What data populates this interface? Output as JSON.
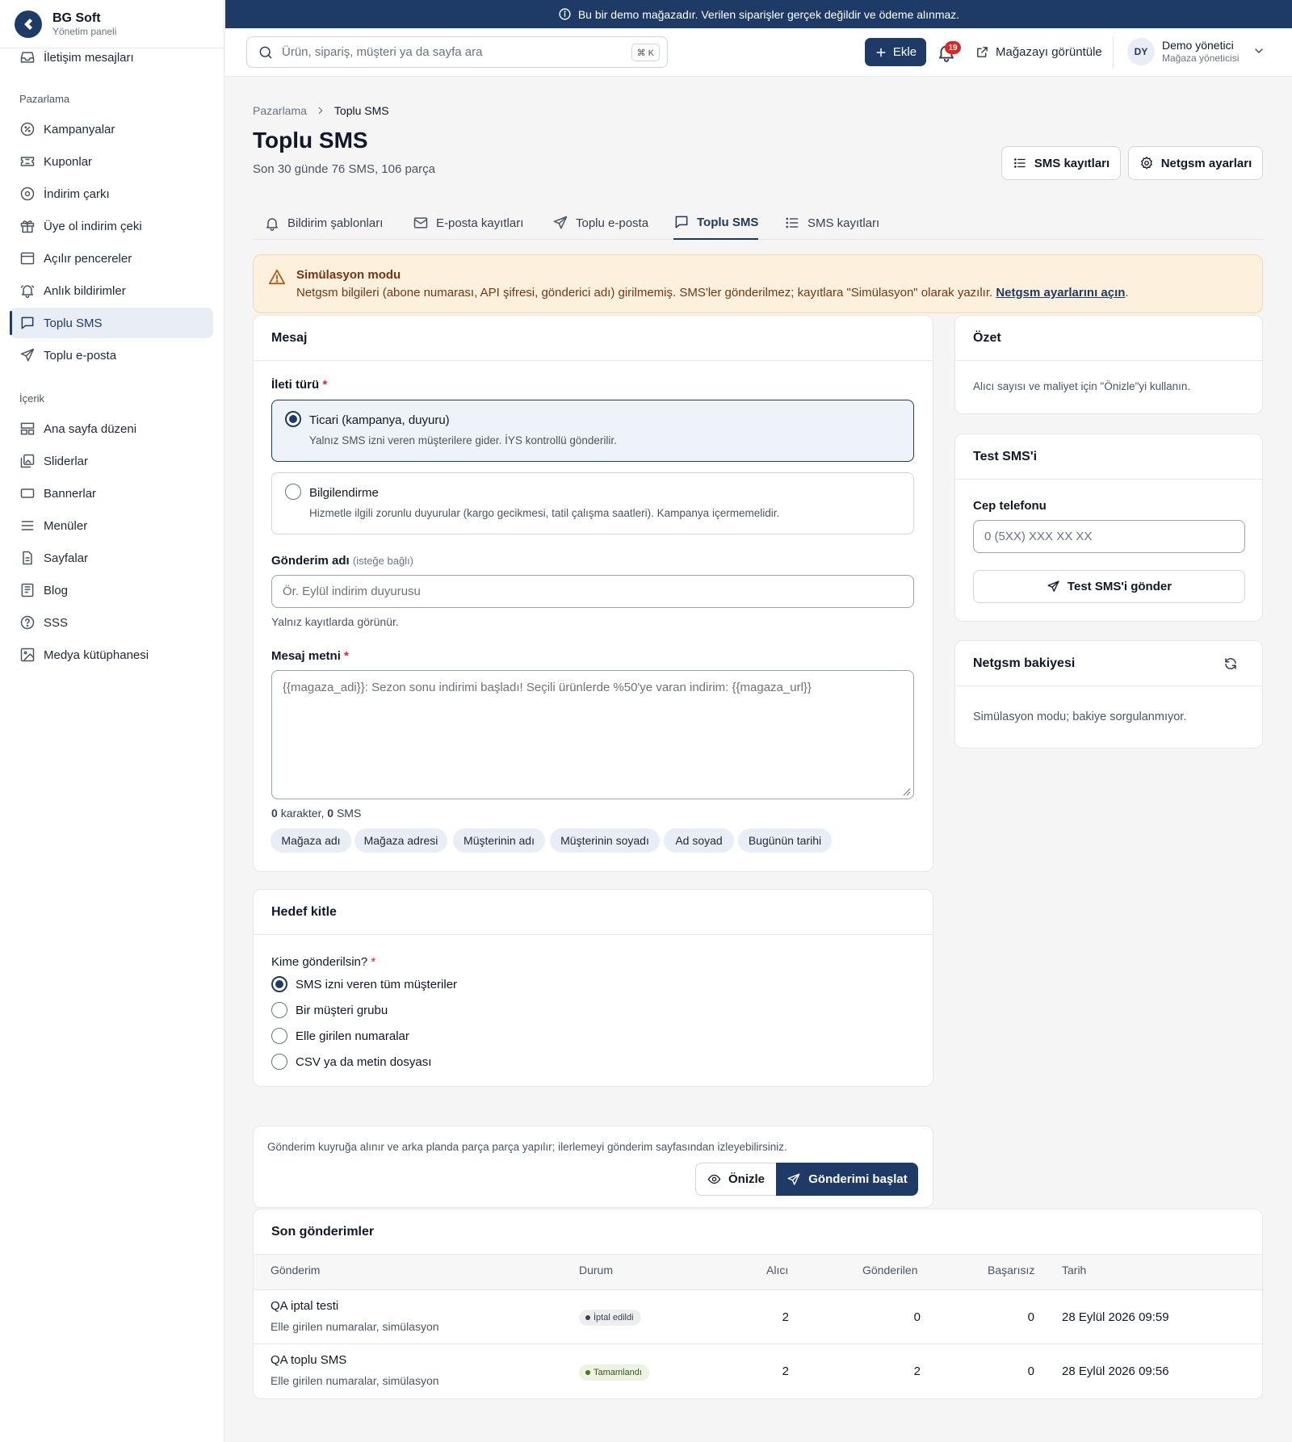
{
  "banner": {
    "text": "Bu bir demo mağazadır. Verilen siparişler gerçek değildir ve ödeme alınmaz."
  },
  "brand": {
    "name": "BG Soft",
    "subtitle": "Yönetim paneli"
  },
  "sidebar": {
    "top_item": "İletişim mesajları",
    "sections": [
      {
        "title": "Pazarlama",
        "items": [
          "Kampanyalar",
          "Kuponlar",
          "İndirim çarkı",
          "Üye ol indirim çeki",
          "Açılır pencereler",
          "Anlık bildirimler",
          "Toplu SMS",
          "Toplu e-posta"
        ]
      },
      {
        "title": "İçerik",
        "items": [
          "Ana sayfa düzeni",
          "Sliderlar",
          "Bannerlar",
          "Menüler",
          "Sayfalar",
          "Blog",
          "SSS",
          "Medya kütüphanesi"
        ]
      }
    ],
    "active_item": "Toplu SMS"
  },
  "header": {
    "search_placeholder": "Ürün, sipariş, müşteri ya da sayfa ara",
    "search_shortcut": "⌘ K",
    "add_label": "Ekle",
    "notification_count": "19",
    "view_store_label": "Mağazayı görüntüle",
    "user": {
      "initials": "DY",
      "name": "Demo yönetici",
      "role": "Mağaza yöneticisi"
    }
  },
  "page": {
    "breadcrumb": [
      "Pazarlama",
      "Toplu SMS"
    ],
    "title": "Toplu SMS",
    "subtitle": "Son 30 günde 76 SMS, 106 parça",
    "actions": {
      "sms_logs": "SMS kayıtları",
      "netgsm_settings": "Netgsm ayarları"
    }
  },
  "tabs": [
    "Bildirim şablonları",
    "E-posta kayıtları",
    "Toplu e-posta",
    "Toplu SMS",
    "SMS kayıtları"
  ],
  "alert": {
    "title": "Simülasyon modu",
    "text": "Netgsm bilgileri (abone numarası, API şifresi, gönderici adı) girilmemiş. SMS'ler gönderilmez; kayıtlara \"Simülasyon\" olarak yazılır.",
    "link": "Netgsm ayarlarını açın",
    "period": "."
  },
  "message_card": {
    "title": "Mesaj",
    "type_label": "İleti türü",
    "types": [
      {
        "title": "Ticari (kampanya, duyuru)",
        "desc": "Yalnız SMS izni veren müşterilere gider. İYS kontrollü gönderilir.",
        "selected": true
      },
      {
        "title": "Bilgilendirme",
        "desc": "Hizmetle ilgili zorunlu duyurular (kargo gecikmesi, tatil çalışma saatleri). Kampanya içermemelidir.",
        "selected": false
      }
    ],
    "send_name_label": "Gönderim adı",
    "send_name_optional": "(isteğe bağlı)",
    "send_name_placeholder": "Ör. Eylül indirim duyurusu",
    "send_name_hint": "Yalnız kayıtlarda görünür.",
    "message_label": "Mesaj metni",
    "message_placeholder": "{{magaza_adi}}: Sezon sonu indirimi başladı! Seçili ürünlerde %50'ye varan indirim: {{magaza_url}}",
    "char_count": "0",
    "char_label": "karakter,",
    "sms_count": "0",
    "sms_label": "SMS",
    "variables": [
      "Mağaza adı",
      "Mağaza adresi",
      "Müşterinin adı",
      "Müşterinin soyadı",
      "Ad soyad",
      "Bugünün tarihi"
    ]
  },
  "audience_card": {
    "title": "Hedef kitle",
    "question": "Kime gönderilsin?",
    "options": [
      "SMS izni veren tüm müşteriler",
      "Bir müşteri grubu",
      "Elle girilen numaralar",
      "CSV ya da metin dosyası"
    ],
    "selected_index": 0
  },
  "send_bar": {
    "note": "Gönderim kuyruğa alınır ve arka planda parça parça yapılır; ilerlemeyi gönderim sayfasından izleyebilirsiniz.",
    "preview_label": "Önizle",
    "start_label": "Gönderimi başlat"
  },
  "summary_card": {
    "title": "Özet",
    "text": "Alıcı sayısı ve maliyet için \"Önizle\"yi kullanın."
  },
  "test_card": {
    "title": "Test SMS'i",
    "phone_label": "Cep telefonu",
    "phone_placeholder": "0 (5XX) XXX XX XX",
    "send_label": "Test SMS'i gönder"
  },
  "balance_card": {
    "title": "Netgsm bakiyesi",
    "text": "Simülasyon modu; bakiye sorgulanmıyor."
  },
  "recent": {
    "title": "Son gönderimler",
    "columns": [
      "Gönderim",
      "Durum",
      "Alıcı",
      "Gönderilen",
      "Başarısız",
      "Tarih"
    ],
    "rows": [
      {
        "name": "QA iptal testi",
        "detail": "Elle girilen numaralar, simülasyon",
        "status": "İptal edildi",
        "recipients": "2",
        "sent": "0",
        "failed": "0",
        "date": "28 Eylül 2026 09:59"
      },
      {
        "name": "QA toplu SMS",
        "detail": "Elle girilen numaralar, simülasyon",
        "status": "Tamamlandı",
        "recipients": "2",
        "sent": "2",
        "failed": "0",
        "date": "28 Eylül 2026 09:56"
      }
    ]
  },
  "colors": {
    "primary": "#1e3a66",
    "alert_bg": "#fdf1de",
    "danger": "#dc2626"
  }
}
